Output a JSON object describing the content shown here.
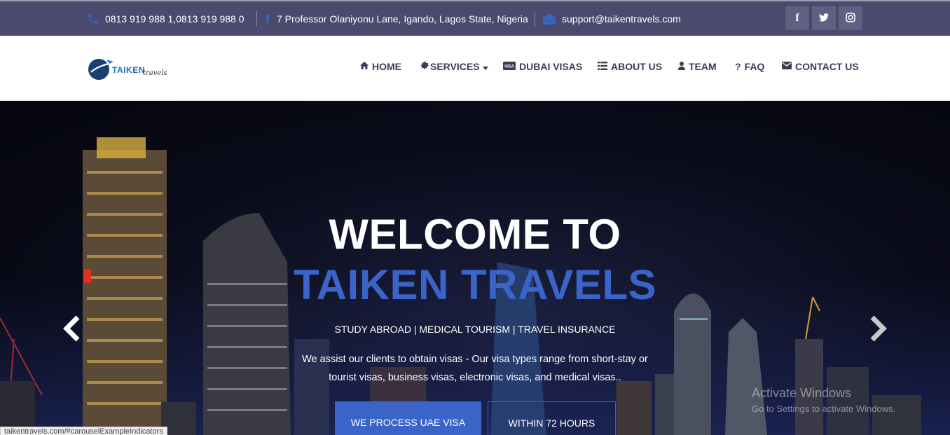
{
  "topbar": {
    "phone": "0813 919 988 1,0813 919 988 0",
    "address": "7 Professor Olaniyonu Lane, Igando, Lagos State, Nigeria",
    "email": "support@taikentravels.com",
    "social": [
      {
        "icon": "facebook-icon",
        "glyph": "f"
      },
      {
        "icon": "twitter-icon",
        "glyph": "t"
      },
      {
        "icon": "instagram-icon",
        "glyph": "ig"
      }
    ]
  },
  "logo": {
    "text": "TAIKEN",
    "script": "travels"
  },
  "nav": {
    "home": "HOME",
    "services": "SERVICES",
    "dubai": "DUBAI VISAS",
    "about": "ABOUT US",
    "team": "TEAM",
    "faq": "FAQ",
    "contact": "CONTACT US"
  },
  "hero": {
    "title1": "WELCOME TO",
    "title2": "TAIKEN TRAVELS",
    "tagline": "STUDY ABROAD | MEDICAL TOURISM | TRAVEL INSURANCE",
    "desc_line1": "We assist our clients to obtain visas - Our visa types range from short-stay or",
    "desc_line2": "tourist visas, business visas, electronic visas, and medical visas..",
    "btn_primary": "WE PROCESS UAE VISA",
    "btn_outline": "WITHIN 72 HOURS"
  },
  "watermark": {
    "line1": "Activate Windows",
    "line2": "Go to Settings to activate Windows."
  },
  "status_url": "taikentravels.com/#carouselExampleIndicators",
  "colors": {
    "topbar": "#4a4a6e",
    "accent": "#3a64c8",
    "nav_text": "#3a3d55"
  }
}
